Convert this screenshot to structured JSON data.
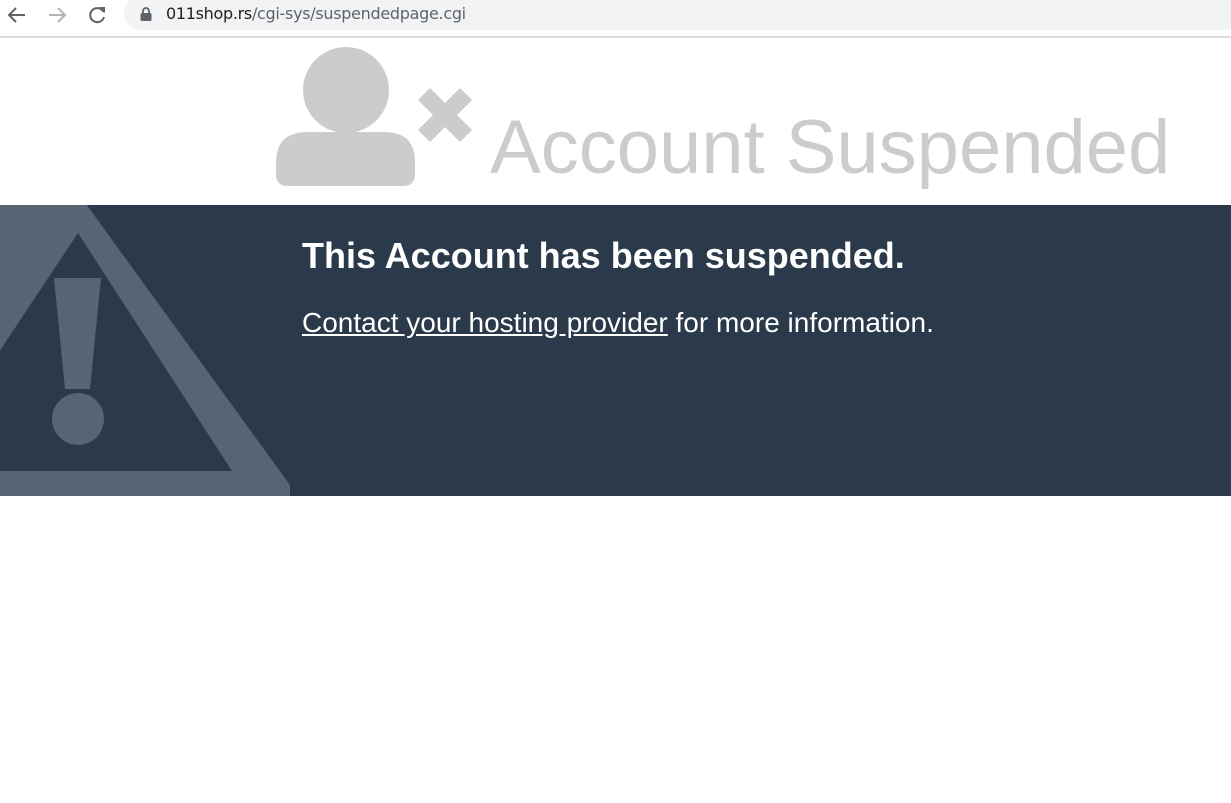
{
  "browser": {
    "url_host": "011shop.rs",
    "url_path": "/cgi-sys/suspendedpage.cgi"
  },
  "header": {
    "title": "Account Suspended"
  },
  "banner": {
    "heading": "This Account has been suspended.",
    "link_text": "Contact your hosting provider",
    "trailing_text": " for more information."
  },
  "icons": {
    "back": "arrow-left-icon",
    "forward": "arrow-right-icon",
    "reload": "reload-icon",
    "lock": "lock-icon",
    "user": "user-x-icon",
    "warning": "warning-triangle-icon"
  },
  "colors": {
    "banner_bg": "#2b3a4a",
    "header_text": "#cccccc",
    "icon_gray": "#cccccc",
    "warning_gray": "#566574"
  }
}
